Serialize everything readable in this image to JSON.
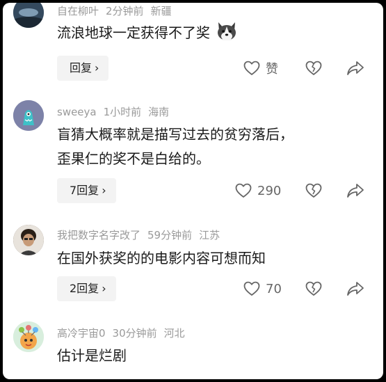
{
  "comments": [
    {
      "username": "自在柳叶",
      "time": "2分钟前",
      "location": "新疆",
      "text_lines": [
        "流浪地球一定获得不了奖"
      ],
      "emoji": "husky-face-icon",
      "reply_label": "回复",
      "like_label": "赞"
    },
    {
      "username": "sweeya",
      "time": "1小时前",
      "location": "海南",
      "text_lines": [
        "盲猜大概率就是描写过去的贫穷落后，",
        "歪果仁的奖不是白给的。"
      ],
      "reply_label": "7回复",
      "like_count": "290"
    },
    {
      "username": "我把数字名字改了",
      "time": "59分钟前",
      "location": "江苏",
      "text_lines": [
        "在国外获奖的的电影内容可想而知"
      ],
      "reply_label": "2回复",
      "like_count": "70"
    },
    {
      "username": "高冷宇宙0",
      "time": "30分钟前",
      "location": "河北",
      "text_lines": [
        "估计是烂剧"
      ]
    }
  ],
  "colors": {
    "meta": "#9a9a9a",
    "text": "#1a1a1a",
    "icon": "#666666"
  }
}
